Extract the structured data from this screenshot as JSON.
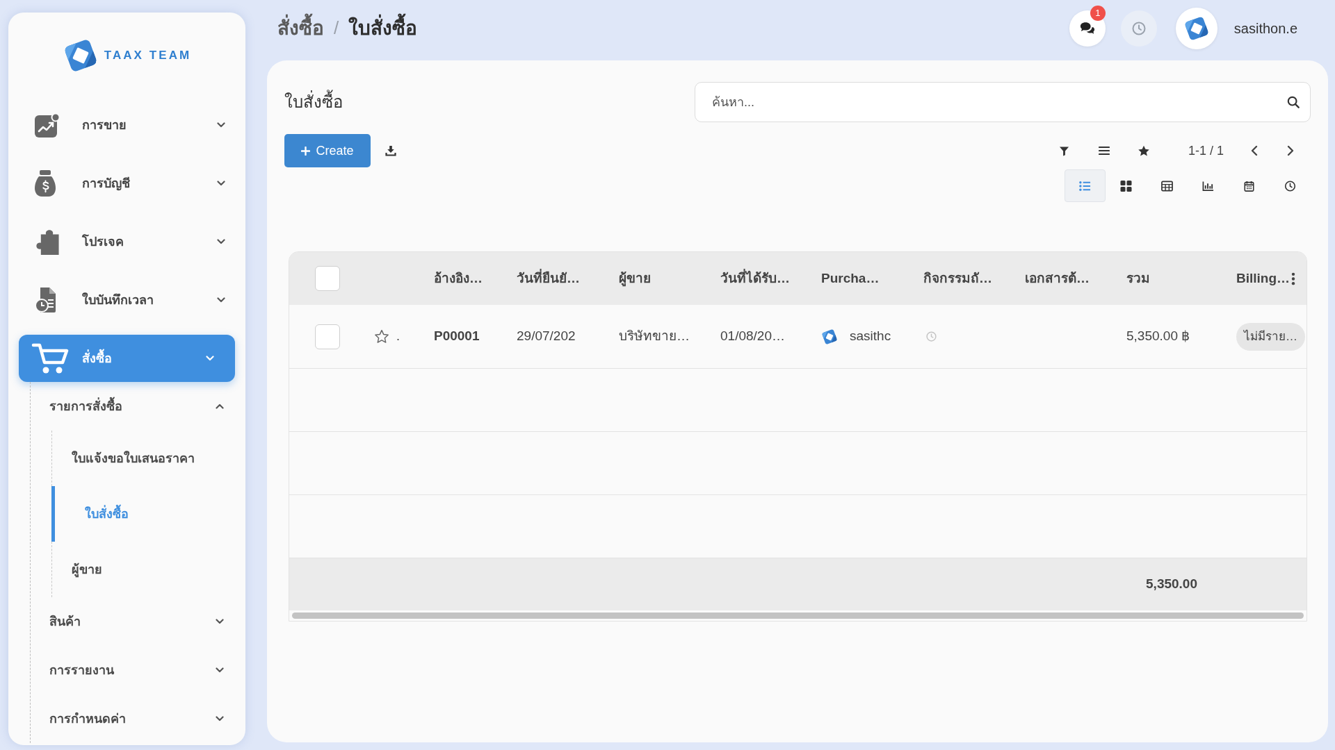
{
  "sidebar": {
    "logo_text": "TAAX TEAM",
    "apps": [
      {
        "label": "การขาย",
        "selected": false
      },
      {
        "label": "การบัญชี",
        "selected": false
      },
      {
        "label": "โปรเจค",
        "selected": false
      },
      {
        "label": "ใบบันทึกเวลา",
        "selected": false
      },
      {
        "label": "สั่งซื้อ",
        "selected": true,
        "children": [
          {
            "label": "รายการสั่งซื้อ",
            "expanded": true,
            "children": [
              {
                "label": "ใบแจ้งขอใบเสนอราคา",
                "selected": false
              },
              {
                "label": "ใบสั่งซื้อ",
                "selected": true
              },
              {
                "label": "ผู้ขาย",
                "selected": false
              }
            ]
          },
          {
            "label": "สินค้า",
            "expanded": false
          },
          {
            "label": "การรายงาน",
            "expanded": false
          },
          {
            "label": "การกำหนดค่า",
            "expanded": false
          }
        ]
      }
    ]
  },
  "breadcrumbs": {
    "separator": "/",
    "items": [
      {
        "label": "สั่งซื้อ",
        "selected": false
      },
      {
        "label": "ใบสั่งซื้อ",
        "selected": true
      }
    ]
  },
  "topbar": {
    "messages_badge": "1",
    "user": {
      "name": "sasithon.e"
    }
  },
  "view": {
    "title": "ใบสั่งซื้อ",
    "search": {
      "placeholder": "ค้นหา..."
    },
    "create_button": "Create",
    "pager": "1-1 / 1",
    "view_modes": [
      {
        "kind": "list",
        "selected": true
      },
      {
        "kind": "kanban",
        "selected": false
      },
      {
        "kind": "pivot",
        "selected": false
      },
      {
        "kind": "graph",
        "selected": false
      },
      {
        "kind": "calendar",
        "selected": false
      },
      {
        "kind": "activity",
        "selected": false
      }
    ]
  },
  "table": {
    "all_selected": false,
    "columns": [
      {
        "label": "อ้างอิง…"
      },
      {
        "label": "วันที่ยืนยั…"
      },
      {
        "label": "ผู้ขาย"
      },
      {
        "label": "วันที่ได้รับ…"
      },
      {
        "label": "Purcha…"
      },
      {
        "label": "กิจกรรมถั…"
      },
      {
        "label": "เอกสารต้…"
      },
      {
        "label": "รวม"
      },
      {
        "label": "Billing…"
      }
    ],
    "rows": [
      {
        "selected": false,
        "starred": false,
        "marker": ".",
        "cells": [
          {
            "kind": "bold",
            "text": "P00001"
          },
          {
            "kind": "text",
            "text": "29/07/202"
          },
          {
            "kind": "text",
            "text": "บริษัทขาย…"
          },
          {
            "kind": "text",
            "text": "01/08/20…"
          },
          {
            "kind": "user",
            "text": "sasithc"
          },
          {
            "kind": "activity"
          },
          {
            "kind": "empty"
          },
          {
            "kind": "amount",
            "text": "5,350.00 ฿"
          },
          {
            "kind": "badge",
            "text": "ไม่มีราย…"
          }
        ]
      }
    ],
    "footer_total": "5,350.00"
  }
}
